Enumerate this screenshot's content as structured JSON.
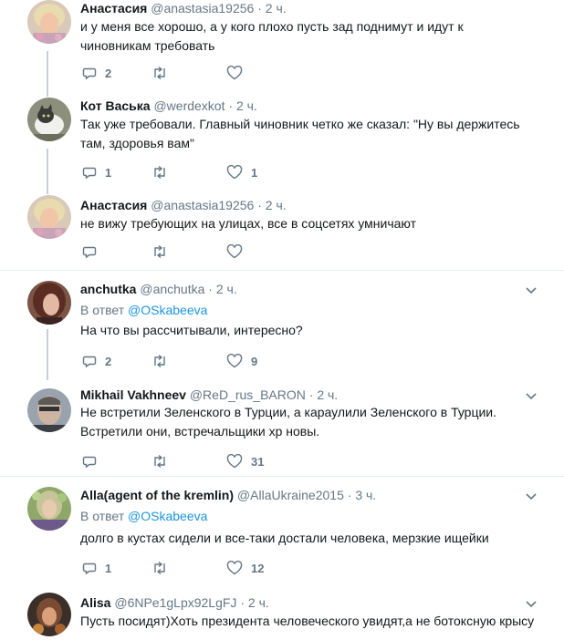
{
  "tweets": [
    {
      "name": "Анастасия",
      "handle": "@anastasia19256",
      "time": "2 ч.",
      "text": "и у меня все хорошо, а у кого плохо пусть зад поднимут и идут к чиновникам требовать",
      "replies": "2",
      "retweets": "",
      "likes": ""
    },
    {
      "name": "Кот Васька",
      "handle": "@werdexkot",
      "time": "2 ч.",
      "text": "Так уже требовали. Главный чиновник четко же сказал: \"Ну вы держитесь там, здоровья вам\"",
      "replies": "1",
      "retweets": "",
      "likes": "1"
    },
    {
      "name": "Анастасия",
      "handle": "@anastasia19256",
      "time": "2 ч.",
      "text": "не вижу требующих на улицах, все в соцсетях умничают",
      "replies": "",
      "retweets": "",
      "likes": ""
    },
    {
      "name": "anchutka",
      "handle": "@anchutka",
      "time": "2 ч.",
      "reply_prefix": "В ответ",
      "reply_to": "@OSkabeeva",
      "text": "На что вы рассчитывали, интересно?",
      "replies": "2",
      "retweets": "",
      "likes": "9"
    },
    {
      "name": "Mikhail Vakhneev",
      "handle": "@ReD_rus_BARON",
      "time": "2 ч.",
      "text": "Не встретили Зеленского в Турции, а караулили Зеленского в Турции. Встретили они, встречальщики хр  новы.",
      "replies": "",
      "retweets": "",
      "likes": "31"
    },
    {
      "name": "Alla(agent of the kremlin)",
      "handle": "@AllaUkraine2015",
      "time": "3 ч.",
      "reply_prefix": "В ответ",
      "reply_to": "@OSkabeeva",
      "text": "долго в кустах сидели и все-таки достали человека, мерзкие ищейки",
      "replies": "1",
      "retweets": "",
      "likes": "12"
    },
    {
      "name": "Alisa",
      "handle": "@6NPe1gLpx92LgFJ",
      "time": "2 ч.",
      "text": "Пусть посидят)Хоть президента человеческого увидят,а не ботоксную крысу"
    }
  ],
  "ui": {
    "separator": "·",
    "accent": "#1b95e0",
    "muted": "#657786",
    "thread_line": "#c4cfd6"
  }
}
